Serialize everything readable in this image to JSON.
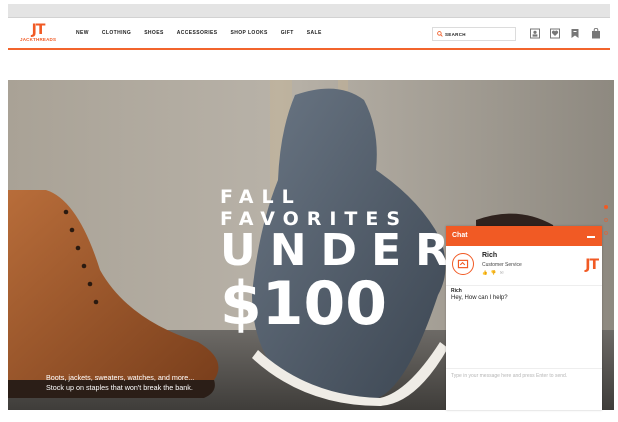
{
  "header": {
    "logo": {
      "mark": "JT",
      "wordmark": "JACKTHREADS"
    },
    "nav": [
      "NEW",
      "CLOTHING",
      "SHOES",
      "ACCESSORIES",
      "SHOP LOOKS",
      "GIFT",
      "SALE"
    ],
    "search": {
      "placeholder": "SEARCH"
    },
    "icons": [
      "account-icon",
      "wishlist-icon",
      "bookmark-icon",
      "bag-icon"
    ]
  },
  "hero": {
    "headline": [
      "FALL",
      "FAVORITES",
      "UNDER",
      "$100"
    ],
    "caption": "Boots, jackets, sweaters, watches, and more... Stock up on staples that won't break the bank."
  },
  "carousel": {
    "dots": 3,
    "active_index": 0
  },
  "chat": {
    "title": "Chat",
    "agent_name": "Rich",
    "agent_role": "Customer Service",
    "agent_logo": "JT",
    "message_sender": "Rich",
    "message_text": "Hey, How can I help?",
    "input_placeholder": "Type in your message here and press Enter to send."
  },
  "colors": {
    "accent": "#f15a24",
    "header_rule": "#f2642c",
    "text": "#222222"
  }
}
